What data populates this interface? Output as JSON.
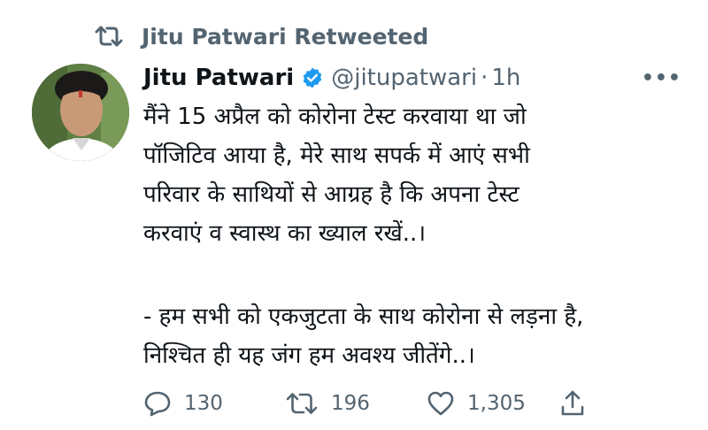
{
  "retweet_context": {
    "label": "Jitu Patwari Retweeted"
  },
  "tweet": {
    "author_name": "Jitu Patwari",
    "handle": "@jitupatwari",
    "separator": "·",
    "timestamp": "1h",
    "more_label": "•••",
    "body_lines": [
      "मैंने 15 अप्रैल को कोरोना टेस्ट करवाया था जो",
      "पॉजिटिव आया है, मेरे साथ सपर्क में आएं सभी",
      "परिवार के साथियों  से आग्रह है कि अपना टेस्ट",
      "करवाएं व स्वास्थ का ख्याल रखें..।",
      "- हम सभी को एकजुटता के साथ कोरोना से लड़ना है,",
      "निश्चित ही यह जंग हम अवश्य जीतेंगे..।"
    ]
  },
  "actions": {
    "reply_count": "130",
    "retweet_count": "196",
    "like_count": "1,305"
  },
  "colors": {
    "text_primary": "#0f1419",
    "text_secondary": "#536471",
    "verified_blue": "#1d9bf0"
  },
  "icons": {
    "retweet": "retweet-icon",
    "verified": "verified-badge-icon",
    "reply": "reply-icon",
    "like": "heart-icon",
    "share": "share-icon",
    "more": "more-icon"
  }
}
